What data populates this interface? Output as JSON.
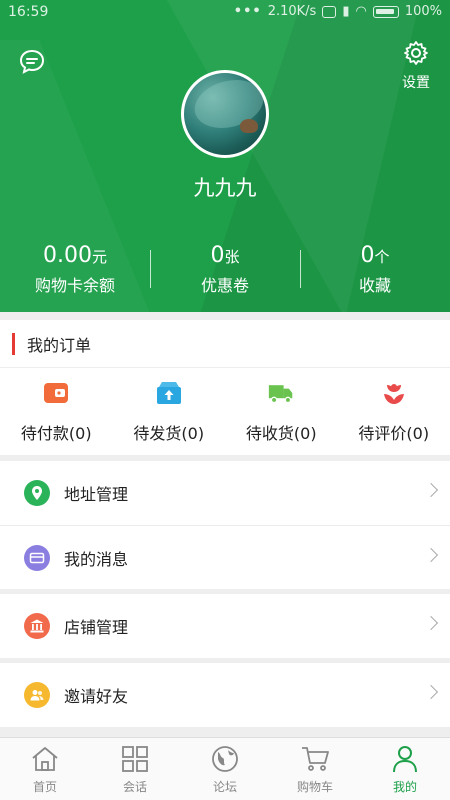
{
  "status_bar": {
    "time": "16:59",
    "network_speed": "2.10K/s",
    "battery": "100%"
  },
  "header": {
    "settings_label": "设置",
    "username": "九九九",
    "stats": [
      {
        "value": "0.00",
        "unit": "元",
        "label": "购物卡余额"
      },
      {
        "value": "0",
        "unit": "张",
        "label": "优惠卷"
      },
      {
        "value": "0",
        "unit": "个",
        "label": "收藏"
      }
    ]
  },
  "orders": {
    "title": "我的订单",
    "items": [
      {
        "label": "待付款(0)",
        "icon": "wallet-icon",
        "color": "#f26b3a"
      },
      {
        "label": "待发货(0)",
        "icon": "box-upload-icon",
        "color": "#2aa6e0"
      },
      {
        "label": "待收货(0)",
        "icon": "truck-icon",
        "color": "#69c34e"
      },
      {
        "label": "待评价(0)",
        "icon": "flower-icon",
        "color": "#e94b4b"
      }
    ]
  },
  "menu": {
    "address": {
      "label": "地址管理",
      "icon": "location-pin-icon",
      "color": "#2bb35a"
    },
    "messages": {
      "label": "我的消息",
      "icon": "card-icon",
      "color": "#8a7ee0"
    },
    "store": {
      "label": "店铺管理",
      "icon": "bank-icon",
      "color": "#f16a4c"
    },
    "invite": {
      "label": "邀请好友",
      "icon": "people-icon",
      "color": "#f5b82e"
    }
  },
  "tabbar": {
    "items": [
      {
        "label": "首页",
        "icon": "home-icon"
      },
      {
        "label": "会话",
        "icon": "grid-icon"
      },
      {
        "label": "论坛",
        "icon": "globe-icon"
      },
      {
        "label": "购物车",
        "icon": "cart-icon"
      },
      {
        "label": "我的",
        "icon": "person-icon",
        "active": true
      }
    ],
    "active_color": "#1ea04a"
  }
}
